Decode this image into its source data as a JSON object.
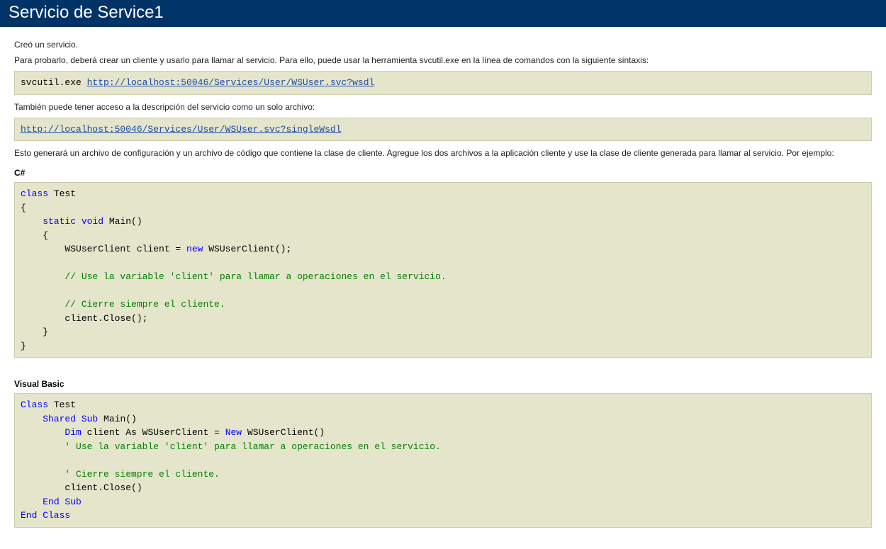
{
  "header": {
    "title": "Servicio de Service1"
  },
  "intro": {
    "created": "Creó un servicio.",
    "test_instructions": "Para probarlo, deberá crear un cliente y usarlo para llamar al servicio. Para ello, puede usar la herramienta svcutil.exe en la línea de comandos con la siguiente sintaxis:"
  },
  "cmd": {
    "tool": "svcutil.exe ",
    "wsdl_url": "http://localhost:50046/Services/User/WSUser.svc?wsdl"
  },
  "single_wsdl_intro": "También puede tener acceso a la descripción del servicio como un solo archivo:",
  "single_wsdl_url": "http://localhost:50046/Services/User/WSUser.svc?singleWsdl",
  "generated_info": "Esto generará un archivo de configuración y un archivo de código que contiene la clase de cliente. Agregue los dos archivos a la aplicación cliente y use la clase de cliente generada para llamar al servicio. Por ejemplo:",
  "csharp": {
    "label": "C#",
    "kw_class": "class",
    "name_test": " Test",
    "brace_open": "{",
    "indent1": "    ",
    "kw_static": "static",
    "kw_void": " void",
    "main_sig": " Main()",
    "brace_open2": "    {",
    "line_client_decl_pre": "        WSUserClient client = ",
    "kw_new": "new",
    "line_client_decl_post": " WSUserClient();",
    "blank": "",
    "comment_use": "        // Use la variable 'client' para llamar a operaciones en el servicio.",
    "comment_close": "        // Cierre siempre el cliente.",
    "line_close": "        client.Close();",
    "brace_close2": "    }",
    "brace_close": "}"
  },
  "vb": {
    "label": "Visual Basic",
    "kw_class": "Class",
    "name_test": " Test",
    "indent1": "    ",
    "kw_shared": "Shared",
    "kw_sub": " Sub",
    "main_sig": " Main()",
    "indent2": "        ",
    "kw_dim": "Dim",
    "client_as": " client As ",
    "type_name": "WSUserClient",
    "eq": " = ",
    "kw_new": "New",
    "ctor": " WSUserClient()",
    "comment_use": "        ' Use la variable 'client' para llamar a operaciones en el servicio.",
    "blank": "",
    "comment_close": "        ' Cierre siempre el cliente.",
    "line_close": "        client.Close()",
    "kw_end_sub": "End Sub",
    "kw_end_class": "End Class"
  }
}
